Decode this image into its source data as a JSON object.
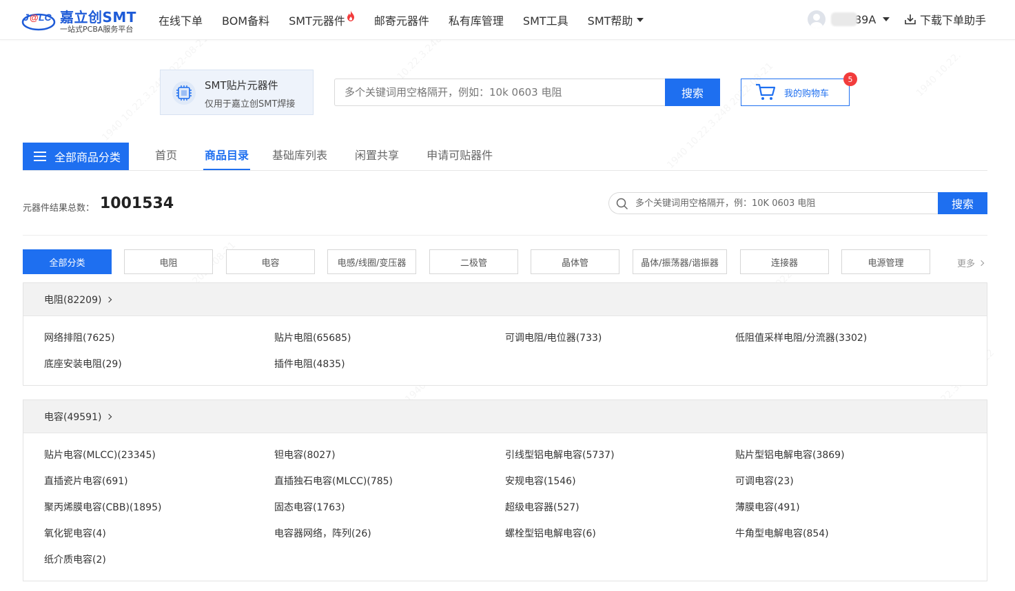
{
  "header": {
    "logo_mark": "J@LC",
    "logo_title": "嘉立创SMT",
    "logo_subtitle": "一站式PCBA服务平台",
    "nav": [
      {
        "label": "在线下单"
      },
      {
        "label": "BOM备料"
      },
      {
        "label": "SMT元器件",
        "hot": true
      },
      {
        "label": "邮寄元器件"
      },
      {
        "label": "私有库管理"
      },
      {
        "label": "SMT工具"
      },
      {
        "label": "SMT帮助",
        "dropdown": true
      }
    ],
    "user_name": "89A",
    "download_label": "下载下单助手"
  },
  "banner": {
    "smt_title": "SMT贴片元器件",
    "smt_subtitle": "仅用于嘉立创SMT焊接",
    "search_placeholder": "多个关键词用空格隔开，例如：10k 0603 电阻",
    "search_button": "搜索",
    "cart_label": "我的购物车",
    "cart_count": "5"
  },
  "tabbar": {
    "all_categories": "全部商品分类",
    "tabs": [
      {
        "label": "首页",
        "active": false
      },
      {
        "label": "商品目录",
        "active": true
      },
      {
        "label": "基础库列表",
        "active": false
      },
      {
        "label": "闲置共享",
        "active": false
      },
      {
        "label": "申请可贴器件",
        "active": false
      }
    ]
  },
  "results": {
    "count_label": "元器件结果总数：",
    "count_value": "1001534",
    "search_placeholder": "多个关键词用空格隔开，例：10K 0603 电阻",
    "search_button": "搜索"
  },
  "category_pills": [
    {
      "label": "全部分类",
      "active": true
    },
    {
      "label": "电阻",
      "active": false
    },
    {
      "label": "电容",
      "active": false
    },
    {
      "label": "电感/线圈/变压器",
      "active": false
    },
    {
      "label": "二极管",
      "active": false
    },
    {
      "label": "晶体管",
      "active": false
    },
    {
      "label": "晶体/振荡器/谐振器",
      "active": false
    },
    {
      "label": "连接器",
      "active": false
    },
    {
      "label": "电源管理",
      "active": false
    }
  ],
  "more_label": "更多",
  "panels": [
    {
      "title": "电阻(82209)",
      "items": [
        "网络排阻(7625)",
        "贴片电阻(65685)",
        "可调电阻/电位器(733)",
        "低阻值采样电阻/分流器(3302)",
        "底座安装电阻(29)",
        "插件电阻(4835)"
      ]
    },
    {
      "title": "电容(49591)",
      "items": [
        "贴片电容(MLCC)(23345)",
        "钽电容(8027)",
        "引线型铝电解电容(5737)",
        "贴片型铝电解电容(3869)",
        "直插瓷片电容(691)",
        "直插独石电容(MLCC)(785)",
        "安规电容(1546)",
        "可调电容(23)",
        "聚丙烯膜电容(CBB)(1895)",
        "固态电容(1763)",
        "超级电容器(527)",
        "薄膜电容(491)",
        "氧化铌电容(4)",
        "电容器网络，阵列(26)",
        "螺栓型铝电解电容(6)",
        "牛角型电解电容(854)",
        "纸介质电容(2)"
      ]
    }
  ],
  "colors": {
    "primary": "#1e6ff0",
    "logo_blue": "#1e5bd7",
    "badge_red": "#f23c3c",
    "hot_red": "#f23c3c"
  },
  "icons": [
    "logo-mark-icon",
    "fire-icon",
    "caret-icon",
    "avatar-icon",
    "download-icon",
    "chip-icon",
    "cart-icon",
    "menu-icon",
    "search-icon",
    "chevron-right-icon"
  ]
}
